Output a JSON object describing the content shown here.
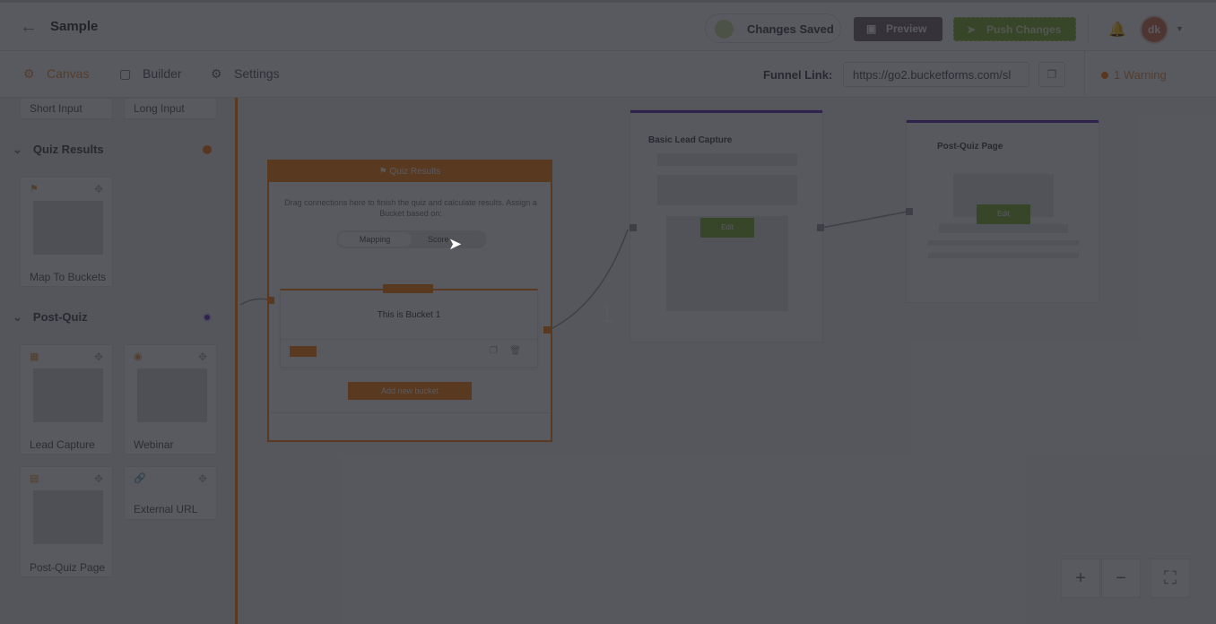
{
  "header": {
    "title": "Sample",
    "changes_saved": "Changes Saved",
    "preview": "Preview",
    "publish": "Push Changes",
    "avatar_initials": "dk"
  },
  "subnav": {
    "tabs": [
      {
        "label": "Canvas",
        "icon": "canvas-icon"
      },
      {
        "label": "Builder",
        "icon": "builder-icon"
      },
      {
        "label": "Settings",
        "icon": "gear-icon"
      }
    ],
    "funnel_label": "Funnel Link:",
    "funnel_url": "https://go2.bucketforms.com/sl",
    "warning": "1 Warning"
  },
  "sidebar": {
    "top_chips": [
      "Short Input",
      "Long Input"
    ],
    "quiz_results": {
      "heading": "Quiz Results",
      "cards": [
        "Map To Buckets"
      ]
    },
    "post_quiz": {
      "heading": "Post-Quiz",
      "cards": [
        "Lead Capture",
        "Webinar",
        "Post-Quiz Page",
        "External URL"
      ]
    }
  },
  "canvas": {
    "quiz_results": {
      "title": "Quiz Results",
      "instructions": "Drag connections here to finish the quiz and calculate results. Assign a Bucket based on:",
      "seg_mapping": "Mapping",
      "seg_score": "Score",
      "bucket_title": "This is Bucket 1",
      "add_bucket": "Add new bucket"
    },
    "lead_capture_node": {
      "title": "Basic Lead Capture",
      "button": "Edit"
    },
    "post_quiz_node": {
      "title": "Post-Quiz Page",
      "button": "Edit"
    },
    "step_number": "1"
  },
  "colors": {
    "accent": "#ff8a1f",
    "publish": "#86b23b",
    "node_top": "#6a3bbd",
    "overlay": "rgba(25,27,33,0.72)"
  }
}
